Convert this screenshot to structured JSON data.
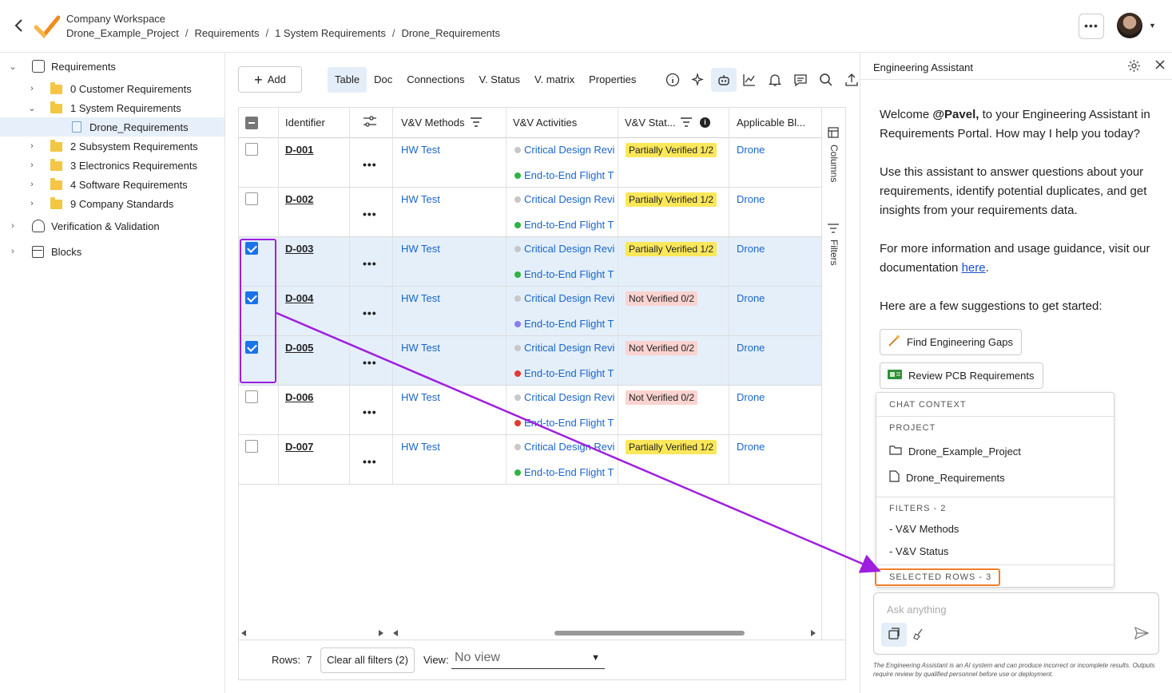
{
  "header": {
    "workspace": "Company Workspace",
    "breadcrumb": [
      "Drone_Example_Project",
      "Requirements",
      "1 System Requirements",
      "Drone_Requirements"
    ],
    "more_label": "•••"
  },
  "tree": {
    "items": [
      {
        "label": "Requirements",
        "icon": "requirements-icon"
      },
      {
        "label": "0 Customer Requirements",
        "icon": "folder-icon"
      },
      {
        "label": "1 System Requirements",
        "icon": "folder-icon"
      },
      {
        "label": "Drone_Requirements",
        "icon": "document-icon"
      },
      {
        "label": "2 Subsystem Requirements",
        "icon": "folder-icon"
      },
      {
        "label": "3 Electronics Requirements",
        "icon": "folder-icon"
      },
      {
        "label": "4 Software Requirements",
        "icon": "folder-icon"
      },
      {
        "label": "9 Company Standards",
        "icon": "folder-icon"
      },
      {
        "label": "Verification & Validation",
        "icon": "verification-icon"
      },
      {
        "label": "Blocks",
        "icon": "blocks-icon"
      }
    ]
  },
  "toolbar": {
    "add_label": "Add",
    "tabs": [
      "Table",
      "Doc",
      "Connections",
      "V. Status",
      "V. matrix",
      "Properties"
    ],
    "active_tab": "Table"
  },
  "table": {
    "columns": [
      "Identifier",
      "V&V Methods",
      "V&V Activities",
      "V&V Stat...",
      "Applicable Bl..."
    ],
    "rows": [
      {
        "id": "D-001",
        "method": "HW Test",
        "act1": "Critical Design Revi",
        "act2": "End-to-End Flight T",
        "status": "Partially Verified 1/2",
        "block": "Drone",
        "selected": false
      },
      {
        "id": "D-002",
        "method": "HW Test",
        "act1": "Critical Design Revi",
        "act2": "End-to-End Flight T",
        "status": "Partially Verified 1/2",
        "block": "Drone",
        "selected": false
      },
      {
        "id": "D-003",
        "method": "HW Test",
        "act1": "Critical Design Revi",
        "act2": "End-to-End Flight T",
        "status": "Partially Verified 1/2",
        "block": "Drone",
        "selected": true
      },
      {
        "id": "D-004",
        "method": "HW Test",
        "act1": "Critical Design Revi",
        "act2": "End-to-End Flight T",
        "status": "Not Verified 0/2",
        "block": "Drone",
        "selected": true
      },
      {
        "id": "D-005",
        "method": "HW Test",
        "act1": "Critical Design Revi",
        "act2": "End-to-End Flight T",
        "status": "Not Verified 0/2",
        "block": "Drone",
        "selected": true
      },
      {
        "id": "D-006",
        "method": "HW Test",
        "act1": "Critical Design Revi",
        "act2": "End-to-End Flight T",
        "status": "Not Verified 0/2",
        "block": "Drone",
        "selected": false
      },
      {
        "id": "D-007",
        "method": "HW Test",
        "act1": "Critical Design Revi",
        "act2": "End-to-End Flight T",
        "status": "Partially Verified 1/2",
        "block": "Drone",
        "selected": false
      }
    ],
    "act2_dot_colors": [
      "#2fb344",
      "#2fb344",
      "#2fb344",
      "#8a7cf0",
      "#e53935",
      "#e53935",
      "#2fb344"
    ],
    "act1_dot_color": "#c8c8c8",
    "side_columns_label": "Columns",
    "side_filters_label": "Filters"
  },
  "footer": {
    "rows_label": "Rows:",
    "rows_count": "7",
    "clear_filters": "Clear all filters (2)",
    "view_label": "View:",
    "view_value": "No view"
  },
  "assistant": {
    "title": "Engineering Assistant",
    "welcome_pre": "Welcome ",
    "welcome_user": "@Pavel,",
    "welcome_post": " to your Engineering Assistant in Requirements Portal. How may I help you today?",
    "para2": "Use this assistant to answer questions about your requirements, identify potential duplicates, and get insights from your requirements data.",
    "para3_pre": "For more information and usage guidance, visit our documentation ",
    "para3_link": "here",
    "para3_post": ".",
    "para4": "Here are a few suggestions to get started:",
    "suggestions": [
      "Find Engineering Gaps",
      "Review PCB Requirements"
    ],
    "context": {
      "title": "CHAT CONTEXT",
      "project_label": "PROJECT",
      "project": "Drone_Example_Project",
      "document": "Drone_Requirements",
      "filters_label": "FILTERS - 2",
      "filters": [
        "- V&V Methods",
        "- V&V Status"
      ],
      "selected_rows": "SELECTED ROWS - 3"
    },
    "input_placeholder": "Ask anything",
    "disclaimer": "The Engineering Assistant is an AI system and can produce incorrect or incomplete results. Outputs require review by qualified personnel before use or deployment."
  },
  "colors": {
    "accent": "#1a73e8",
    "link": "#1a66c9",
    "selected_row": "#e4effa",
    "annotation": "#a01ee0",
    "highlight": "#f07e28",
    "partial": "#fbe75a",
    "not_verified": "#fbd3d0"
  }
}
